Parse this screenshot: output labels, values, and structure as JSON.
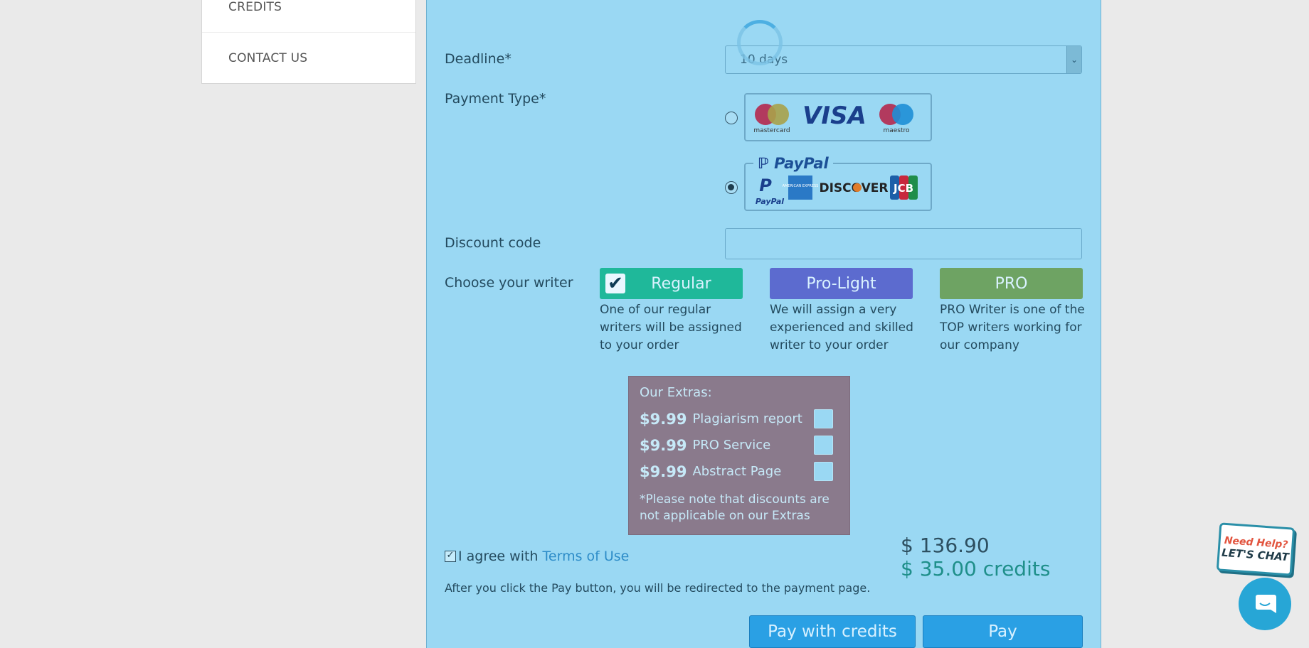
{
  "sidebar": {
    "items": [
      {
        "label": "CREDITS"
      },
      {
        "label": "CONTACT US"
      }
    ]
  },
  "form": {
    "deadline_label": "Deadline*",
    "deadline_value": "10 days",
    "payment_label": "Payment Type*",
    "payment_options": [
      {
        "name": "card",
        "checked": false,
        "logos": [
          "mastercard",
          "VISA",
          "maestro"
        ]
      },
      {
        "name": "paypal",
        "checked": true,
        "header": "PayPal",
        "logos": [
          "PayPal",
          "AMERICAN EXPRESS",
          "DISCOVER",
          "JCB"
        ]
      }
    ],
    "discount_label": "Discount code",
    "discount_value": "",
    "writer_label": "Choose your writer",
    "writers": [
      {
        "label": "Regular",
        "desc": "One of our regular writers will be assigned to your order",
        "selected": true,
        "color": "#1fb89a"
      },
      {
        "label": "Pro-Light",
        "desc": "We will assign a very experienced and skilled writer to your order",
        "selected": false,
        "color": "#5c6bcf"
      },
      {
        "label": "PRO",
        "desc": "PRO Writer is one of the TOP writers working for our company",
        "selected": false,
        "color": "#6ea363"
      }
    ]
  },
  "extras": {
    "title": "Our Extras:",
    "items": [
      {
        "price": "$9.99",
        "name": "Plagiarism report",
        "checked": false
      },
      {
        "price": "$9.99",
        "name": "PRO Service",
        "checked": false
      },
      {
        "price": "$9.99",
        "name": "Abstract Page",
        "checked": false
      }
    ],
    "note": "*Please note that discounts are not applicable on our Extras"
  },
  "agree": {
    "checked": true,
    "text": "I agree with",
    "link": "Terms of Use"
  },
  "redirect_note": "After you click the Pay button, you will be redirected to the payment page.",
  "totals": {
    "price": "$ 136.90",
    "credits": "$ 35.00 credits"
  },
  "buttons": {
    "pay_credits": "Pay with credits",
    "pay": "Pay"
  },
  "chat": {
    "line1": "Need Help?",
    "line2": "LET'S CHAT"
  },
  "colors": {
    "panel": "#9ad8f3",
    "accent": "#2aa0e4",
    "credits_text": "#1f8f8a"
  }
}
